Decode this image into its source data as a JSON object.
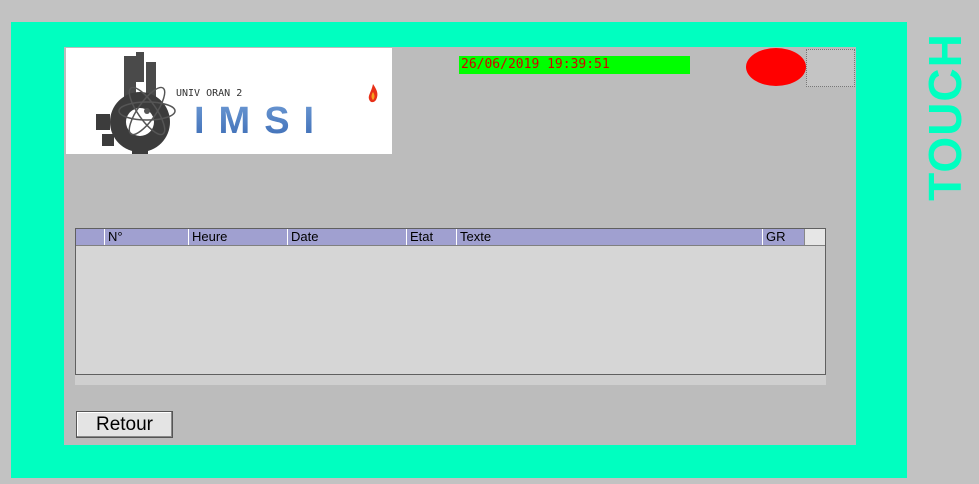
{
  "panel": {
    "side_label": "TOUCH"
  },
  "logo": {
    "subtitle": "UNIV ORAN 2",
    "name": "IMSI"
  },
  "header": {
    "datetime": "26/06/2019 19:39:51"
  },
  "alarm_table": {
    "columns": [
      "N°",
      "Heure",
      "Date",
      "Etat",
      "Texte",
      "GR"
    ],
    "rows": []
  },
  "footer": {
    "back_label": "Retour"
  },
  "colors": {
    "bezel": "#00ffc0",
    "clock_bg": "#00ff00",
    "clock_text": "#d40000",
    "alarm": "#ff0000",
    "table_header": "#a0a0d0"
  }
}
